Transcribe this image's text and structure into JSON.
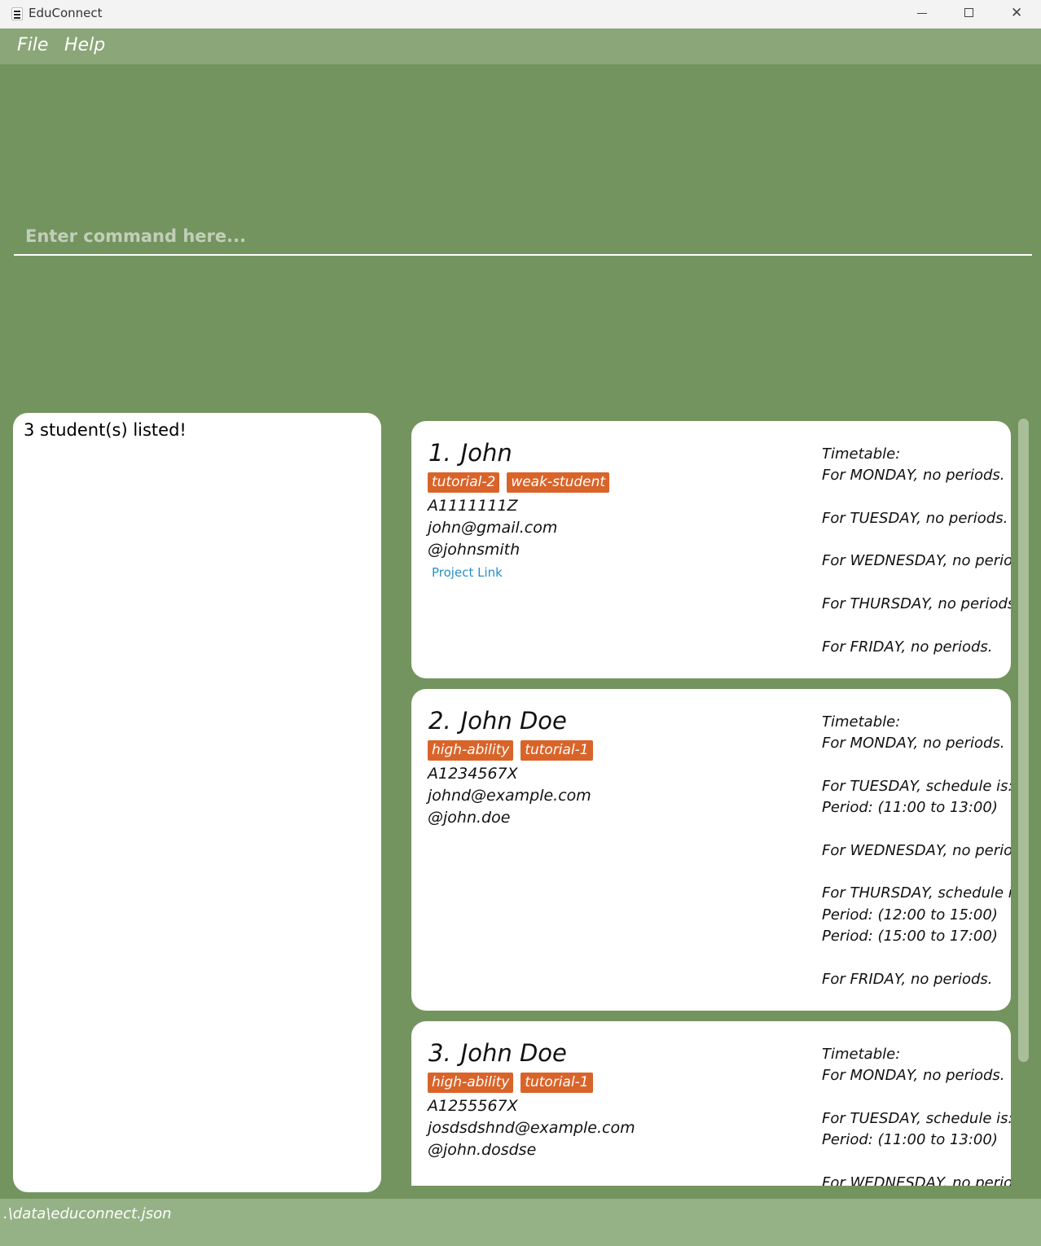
{
  "window": {
    "title": "EduConnect",
    "close_glyph": "✕"
  },
  "menu": {
    "file": "File",
    "help": "Help"
  },
  "command": {
    "placeholder": "Enter command here..."
  },
  "result": {
    "text": "3 student(s) listed!"
  },
  "students": [
    {
      "index": "1.",
      "name": "John",
      "tags": [
        "tutorial-2",
        "weak-student"
      ],
      "student_id": "A1111111Z",
      "email": "john@gmail.com",
      "telegram": "@johnsmith",
      "link": "Project Link",
      "timetable_title": "Timetable:",
      "timetable": [
        [
          "For MONDAY, no periods."
        ],
        [
          "For TUESDAY, no periods."
        ],
        [
          "For WEDNESDAY, no periods."
        ],
        [
          "For THURSDAY, no periods."
        ],
        [
          "For FRIDAY, no periods."
        ]
      ]
    },
    {
      "index": "2.",
      "name": "John Doe",
      "tags": [
        "high-ability",
        "tutorial-1"
      ],
      "student_id": "A1234567X",
      "email": "johnd@example.com",
      "telegram": "@john.doe",
      "timetable_title": "Timetable:",
      "timetable": [
        [
          "For MONDAY, no periods."
        ],
        [
          "For TUESDAY, schedule is:",
          "Period: (11:00 to 13:00)"
        ],
        [
          "For WEDNESDAY, no periods."
        ],
        [
          "For THURSDAY, schedule is:",
          "Period: (12:00 to 15:00)",
          "Period: (15:00 to 17:00)"
        ],
        [
          "For FRIDAY, no periods."
        ]
      ]
    },
    {
      "index": "3.",
      "name": "John Doe",
      "tags": [
        "high-ability",
        "tutorial-1"
      ],
      "student_id": "A1255567X",
      "email": "josdsdshnd@example.com",
      "telegram": "@john.dosdse",
      "timetable_title": "Timetable:",
      "timetable": [
        [
          "For MONDAY, no periods."
        ],
        [
          "For TUESDAY, schedule is:",
          "Period: (11:00 to 13:00)"
        ],
        [
          "For WEDNESDAY, no periods."
        ]
      ]
    }
  ],
  "status": {
    "file_path": ".\\data\\educonnect.json"
  },
  "colors": {
    "background": "#73945f",
    "menubar": "#8ba678",
    "statusbar": "#95b286",
    "tag": "#d9642a",
    "link": "#2a8fc4"
  }
}
